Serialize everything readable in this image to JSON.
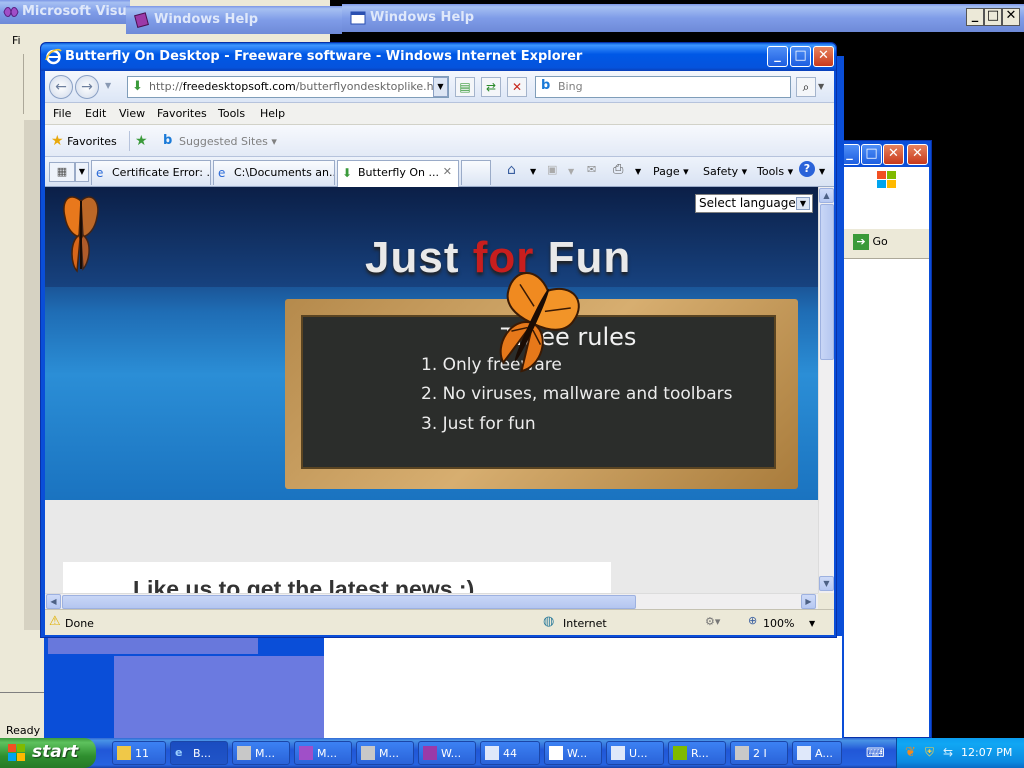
{
  "background_windows": {
    "visual_studio_title": "Microsoft Visual C",
    "help_title_1": "Windows Help",
    "help_title_2": "Windows Help",
    "vs_menu_fi": "Fi",
    "vs_status": "Ready",
    "go_label": "Go"
  },
  "ie": {
    "title": "Butterfly On Desktop - Freeware software - Windows Internet Explorer",
    "address": {
      "prefix": "http://",
      "domain": "freedesktopsoft.com",
      "path": "/butterflyondesktoplike.html"
    },
    "search_placeholder": "Bing",
    "menu": [
      "File",
      "Edit",
      "View",
      "Favorites",
      "Tools",
      "Help"
    ],
    "favorites_label": "Favorites",
    "suggested_sites": "Suggested Sites ▾",
    "tabs": [
      {
        "label": "Certificate Error: ..."
      },
      {
        "label": "C:\\Documents an..."
      },
      {
        "label": "Butterfly On ..."
      }
    ],
    "commands": {
      "page": "Page ▾",
      "safety": "Safety ▾",
      "tools": "Tools ▾"
    },
    "status": {
      "text": "Done",
      "zone": "Internet",
      "zoom": "100%"
    }
  },
  "page": {
    "language_select": "Select language",
    "hero_title_pre": "Just ",
    "hero_title_red": "for",
    "hero_title_post": " Fun",
    "board_heading": "Three rules",
    "rules": [
      "1. Only freeware",
      "2. No viruses, mallware and toolbars",
      "3. Just for fun"
    ],
    "news": "Like us to get the latest news :)"
  },
  "taskbar": {
    "start_label": "start",
    "items": [
      {
        "label": "11"
      },
      {
        "label": "B..."
      },
      {
        "label": "M..."
      },
      {
        "label": "M..."
      },
      {
        "label": "M..."
      },
      {
        "label": "W..."
      },
      {
        "label": "44"
      },
      {
        "label": "W..."
      },
      {
        "label": "U..."
      },
      {
        "label": "R..."
      },
      {
        "label": "2 I"
      },
      {
        "label": "A..."
      }
    ],
    "clock": "12:07 PM"
  },
  "colors": {
    "xp_blue": "#0058e6",
    "close_red": "#c8391c",
    "taskbar_blue": "#2157d7",
    "start_green": "#2f8f2f",
    "tray_blue": "#0b8ae0"
  }
}
